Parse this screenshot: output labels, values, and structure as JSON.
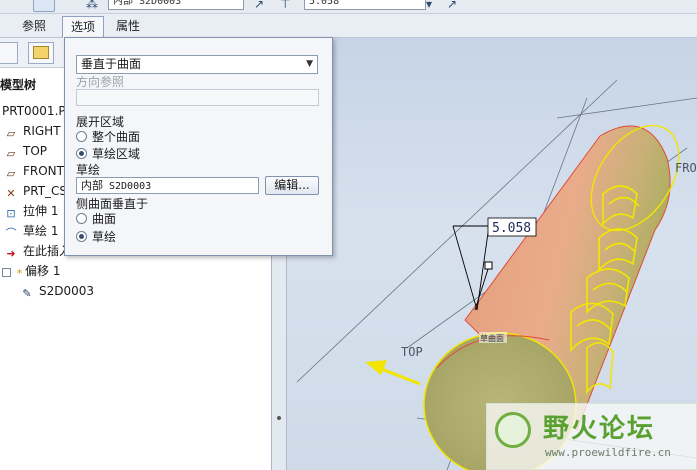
{
  "toolbar": {
    "ref_field_value": "内部 S2D0003",
    "dim_field_value": "5.058",
    "left_field_value": "",
    "top_small_label": "内部"
  },
  "dashboard_tabs": [
    {
      "label": "参照",
      "active": false
    },
    {
      "label": "选项",
      "active": true
    },
    {
      "label": "属性",
      "active": false
    }
  ],
  "options_panel": {
    "direction_select": "垂直于曲面",
    "direction_ref_label": "方向参照",
    "expand_area_label": "展开区域",
    "expand_options": [
      {
        "label": "整个曲面",
        "selected": false
      },
      {
        "label": "草绘区域",
        "selected": true
      }
    ],
    "sketch_label": "草绘",
    "sketch_field": {
      "prefix": "内部",
      "name": "S2D0003"
    },
    "edit_button": "编辑...",
    "side_normal_label": "侧曲面垂直于",
    "side_options": [
      {
        "label": "曲面",
        "selected": false
      },
      {
        "label": "草绘",
        "selected": true
      }
    ]
  },
  "model_tree": {
    "title": "模型树",
    "items": [
      {
        "label": "PRT0001.P",
        "icon": "part-icon"
      },
      {
        "label": "RIGHT",
        "icon": "datum-plane-icon"
      },
      {
        "label": "TOP",
        "icon": "datum-plane-icon"
      },
      {
        "label": "FRONT",
        "icon": "datum-plane-icon"
      },
      {
        "label": "PRT_CS",
        "icon": "csys-icon"
      },
      {
        "label": "拉伸 1",
        "icon": "extrude-icon"
      },
      {
        "label": "草绘 1",
        "icon": "sketch-icon"
      },
      {
        "label": "在此插入",
        "icon": "insert-arrow-icon"
      },
      {
        "label": "偏移 1",
        "icon": "offset-icon"
      },
      {
        "label": "S2D0003",
        "icon": "sketch-edit-icon"
      }
    ]
  },
  "graphics": {
    "dimension_value": "5.058",
    "datum_labels": [
      "TOP",
      "FRO"
    ],
    "surface_tag": "草曲面",
    "accent_yellow": "#f2e600",
    "surface_color": "#e8a785"
  },
  "watermark": {
    "title": "野火论坛",
    "url": "www.proewildfire.cn"
  }
}
